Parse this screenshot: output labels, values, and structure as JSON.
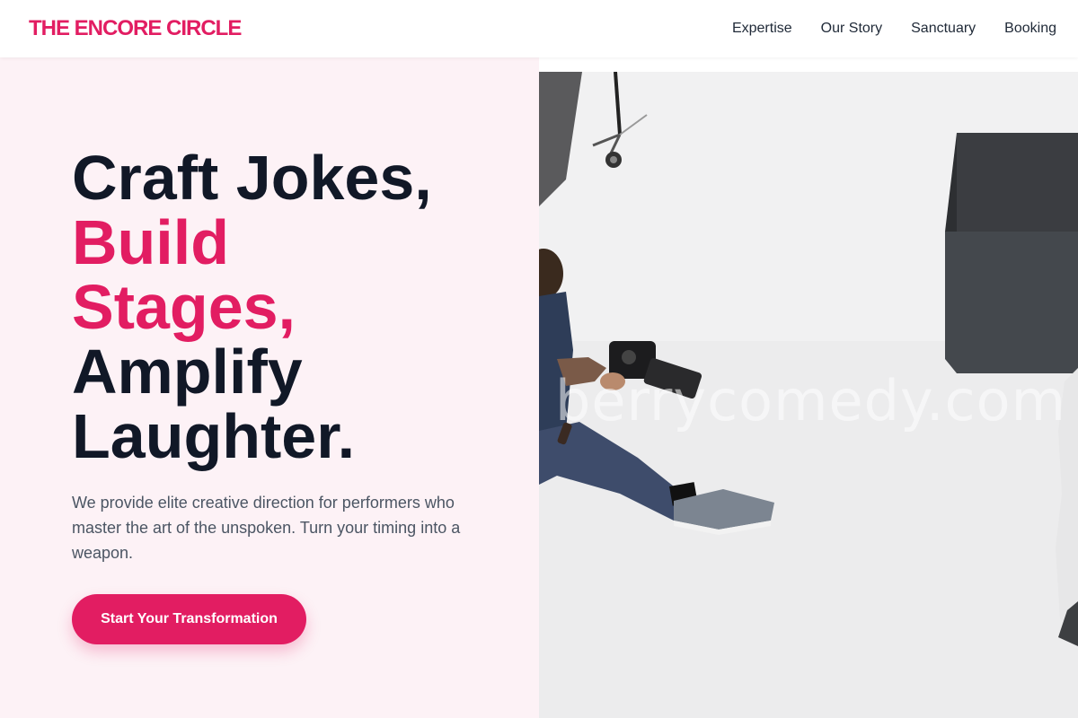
{
  "brand": {
    "name": "THE ENCORE CIRCLE",
    "accent_color": "#e21d62"
  },
  "nav": {
    "links": [
      {
        "label": "Expertise"
      },
      {
        "label": "Our Story"
      },
      {
        "label": "Sanctuary"
      },
      {
        "label": "Booking"
      }
    ]
  },
  "hero": {
    "headline": {
      "line1": "Craft Jokes,",
      "line2": "Build",
      "line3": "Stages,",
      "line4": "Amplify",
      "line5": "Laughter."
    },
    "description": "We provide elite creative direction for performers who master the art of the unspoken. Turn your timing into a weapon.",
    "cta_label": "Start Your Transformation",
    "image": {
      "subject": "photographer-with-camera-in-white-studio",
      "watermark": "berrycomedy.com"
    }
  }
}
